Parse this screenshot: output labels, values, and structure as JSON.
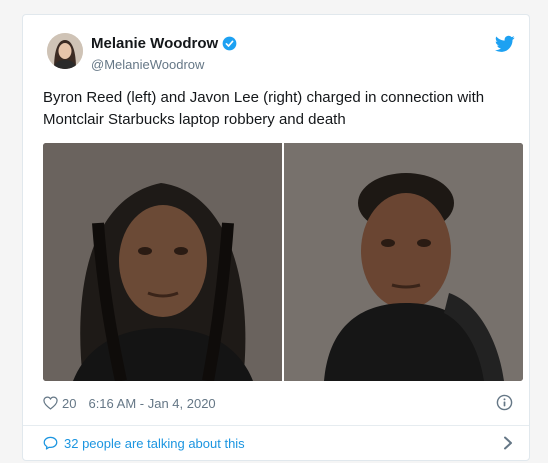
{
  "tweet": {
    "author_name": "Melanie Woodrow",
    "author_handle": "@MelanieWoodrow",
    "text": "Byron Reed (left) and Javon Lee (right) charged in connection with Montclair Starbucks laptop robbery and death",
    "like_count": "20",
    "timestamp": "6:16 AM - Jan 4, 2020",
    "talking_text": "32 people are talking about this"
  },
  "colors": {
    "brand_blue": "#1da1f2",
    "link_blue": "#1b95e0",
    "text_primary": "#14171a",
    "text_secondary": "#657786"
  },
  "icons": [
    "avatar",
    "verified-badge-icon",
    "twitter-bird-icon",
    "heart-icon",
    "info-icon",
    "speech-bubble-icon",
    "chevron-right-icon"
  ]
}
